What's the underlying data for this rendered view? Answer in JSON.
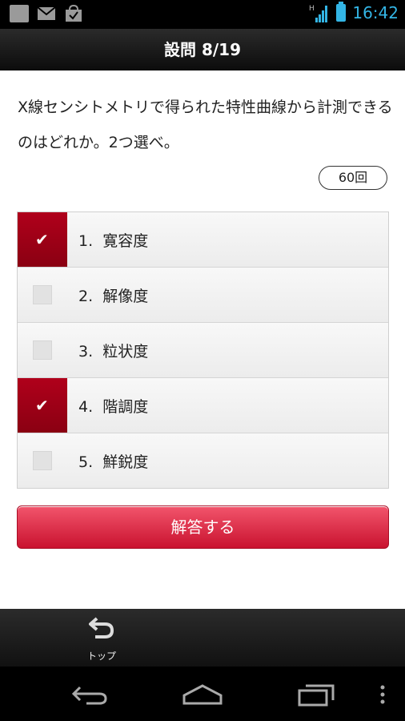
{
  "status_bar": {
    "time": "16:42",
    "icons": [
      "image-icon",
      "gmail-icon",
      "shop-icon"
    ],
    "network": "H"
  },
  "header": {
    "title": "設問 8/19"
  },
  "question": {
    "text": "X線センシトメトリで得られた特性曲線から計測できるのはどれか。2つ選べ。",
    "count_label": "60回"
  },
  "options": [
    {
      "label": "1.  寛容度",
      "checked": true
    },
    {
      "label": "2.  解像度",
      "checked": false
    },
    {
      "label": "3.  粒状度",
      "checked": false
    },
    {
      "label": "4.  階調度",
      "checked": true
    },
    {
      "label": "5.  鮮鋭度",
      "checked": false
    }
  ],
  "answer_button": {
    "label": "解答する"
  },
  "bottom_bar": {
    "top_label": "トップ"
  },
  "colors": {
    "accent": "#c9122f",
    "checked_bg": "#a00018",
    "status_blue": "#33b5e5"
  }
}
